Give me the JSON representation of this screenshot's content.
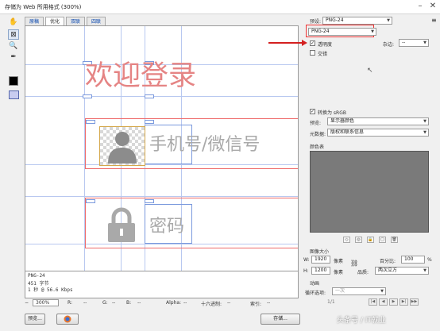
{
  "window": {
    "title": "存储为 Web 所用格式 (300%)",
    "minimize": "–",
    "maximize": "□",
    "close": "✕"
  },
  "tools": {
    "hand": "hand-icon",
    "slice_select": "slice-select-icon",
    "zoom": "zoom-icon",
    "eyedropper": "eyedropper-icon"
  },
  "tabs": [
    {
      "label": "原稿"
    },
    {
      "label": "优化"
    },
    {
      "label": "双联"
    },
    {
      "label": "四联"
    }
  ],
  "canvas": {
    "heading": "欢迎登录",
    "phone_placeholder": "手机号/微信号",
    "password_placeholder": "密码",
    "avatar_icon": "user-silhouette-icon",
    "lock_icon": "lock-icon"
  },
  "info": {
    "format": "PNG-24",
    "size": "451 字节",
    "speed": "1 秒 @ 56.6 Kbps"
  },
  "status": {
    "zoom": "300%",
    "r": "R:",
    "g": "G:",
    "b": "B:",
    "alpha": "Alpha:",
    "hex": "十六进制:",
    "index": "索引:",
    "dash": "--"
  },
  "buttons": {
    "preview": "预览...",
    "save": "存储..."
  },
  "panel": {
    "preset_label": "预设:",
    "preset_value": "PNG-24",
    "format_value": "PNG-24",
    "transparency_label": "透明度",
    "transparency_checked": true,
    "matte_label": "杂边:",
    "matte_value": "--",
    "interlaced_label": "交错",
    "interlaced_checked": false,
    "convert_srgb_label": "转换为 sRGB",
    "convert_srgb_checked": true,
    "preview_label": "预览:",
    "preview_value": "显示器颜色",
    "metadata_label": "元数据:",
    "metadata_value": "版权和联系信息",
    "color_table_label": "颜色表",
    "image_size_label": "图像大小",
    "w_label": "W:",
    "w_value": "1920",
    "h_label": "H:",
    "h_value": "1200",
    "pixels_label": "像素",
    "percent_label": "百分比:",
    "percent_value": "100",
    "percent_unit": "%",
    "quality_label": "品质:",
    "quality_value": "两次立方",
    "animation_label": "动画",
    "loop_label": "循环选项:",
    "loop_value": "一次",
    "frame_counter": "1/1"
  },
  "watermark": "头条号 / IT就业",
  "colors": {
    "accent_red": "#d42020",
    "slice_red": "#ee6a6a",
    "guide_blue": "#7a99dd",
    "heading_pink": "#e58484"
  }
}
